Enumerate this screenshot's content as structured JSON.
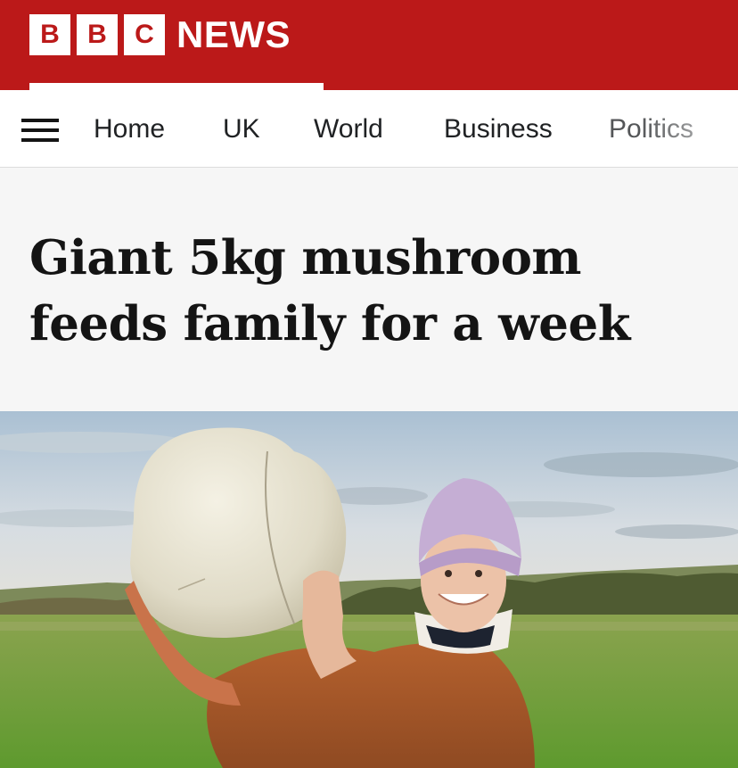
{
  "header": {
    "logo_letters": [
      "B",
      "B",
      "C"
    ],
    "logo_word": "NEWS",
    "brand_color": "#bb1919"
  },
  "nav": {
    "menu_icon": "hamburger-menu-icon",
    "items": [
      {
        "label": "Home"
      },
      {
        "label": "UK"
      },
      {
        "label": "World"
      },
      {
        "label": "Business"
      },
      {
        "label": "Politics"
      }
    ]
  },
  "article": {
    "headline_line1": "Giant 5kg mushroom",
    "headline_line2": "feeds family for a week",
    "image": "woman-holding-giant-puffball-mushroom-in-field"
  }
}
